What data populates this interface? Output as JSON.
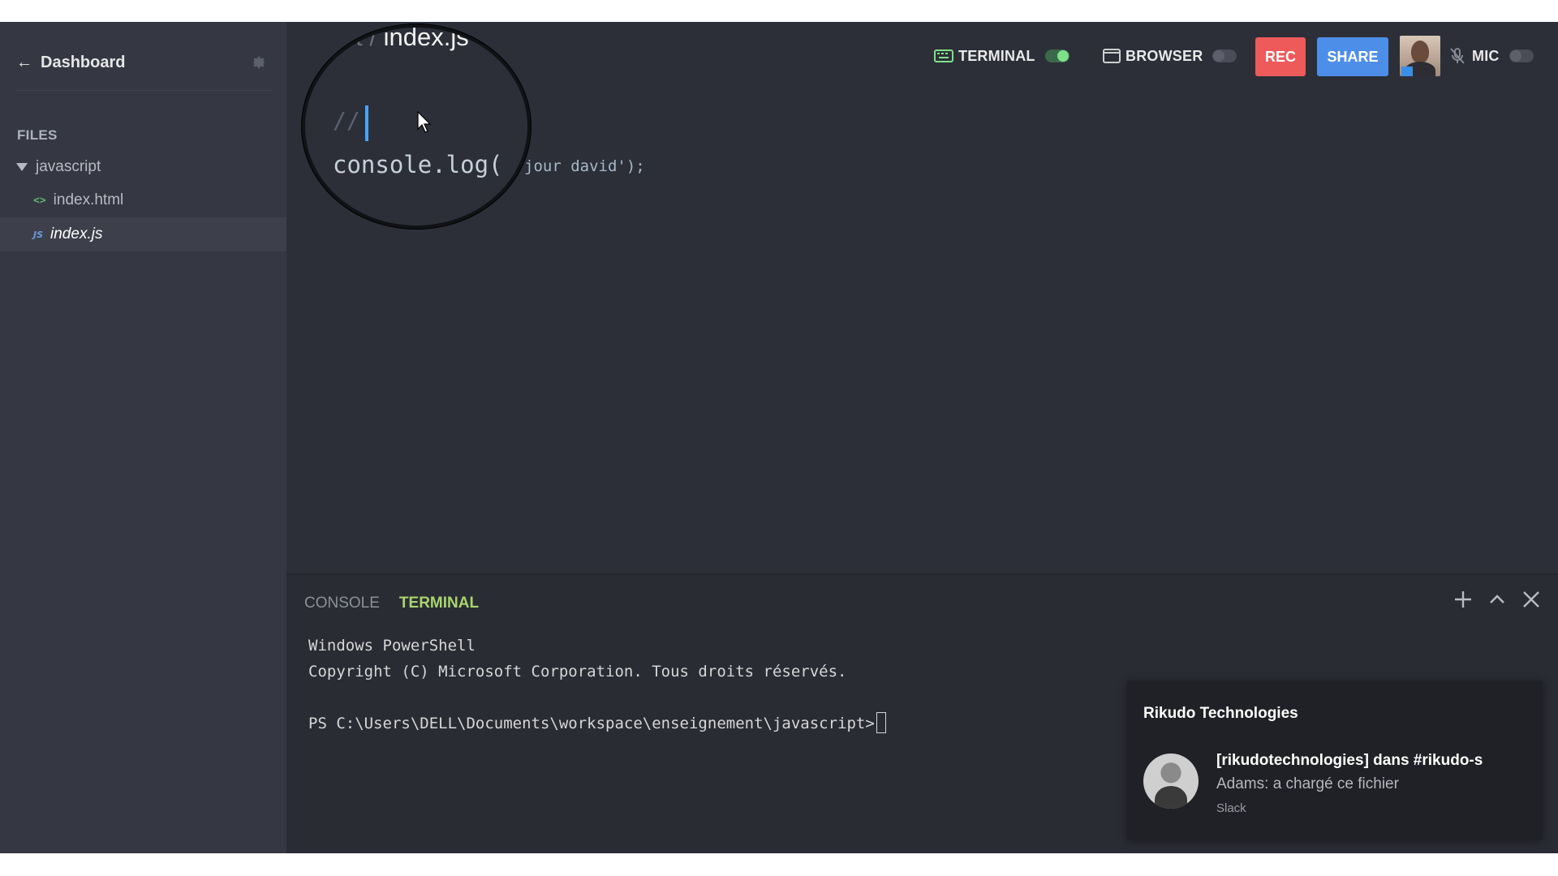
{
  "sidebar": {
    "back_label": "Dashboard",
    "section_label": "FILES",
    "folder": "javascript",
    "files": [
      {
        "name": "index.html",
        "icon": "html-file-icon",
        "active": false
      },
      {
        "name": "index.js",
        "icon": "js-file-icon",
        "active": true
      }
    ]
  },
  "toolbar": {
    "terminal_label": "TERMINAL",
    "terminal_on": true,
    "browser_label": "BROWSER",
    "browser_on": false,
    "rec_label": "REC",
    "share_label": "SHARE",
    "mic_label": "MIC",
    "mic_on": false
  },
  "editor": {
    "breadcrumb_folder": "ipt /",
    "breadcrumb_file": "index.js",
    "comment_text": "//",
    "code_visible": "console.log(",
    "code_tail": "jour david');"
  },
  "panel": {
    "tabs": [
      "CONSOLE",
      "TERMINAL"
    ],
    "active_tab": "TERMINAL",
    "terminal_lines": [
      "Windows PowerShell",
      "Copyright (C) Microsoft Corporation. Tous droits réservés.",
      "",
      "PS C:\\Users\\DELL\\Documents\\workspace\\enseignement\\javascript>"
    ]
  },
  "notification": {
    "app": "Rikudo Technologies",
    "title": "[rikudotechnologies] dans #rikudo-s",
    "body": "Adams: a chargé ce fichier",
    "source": "Slack"
  },
  "colors": {
    "rec": "#ee5a5a",
    "share": "#4d8ee8",
    "terminal_tab": "#a9d46e",
    "toggle_on": "#7fe08a"
  }
}
